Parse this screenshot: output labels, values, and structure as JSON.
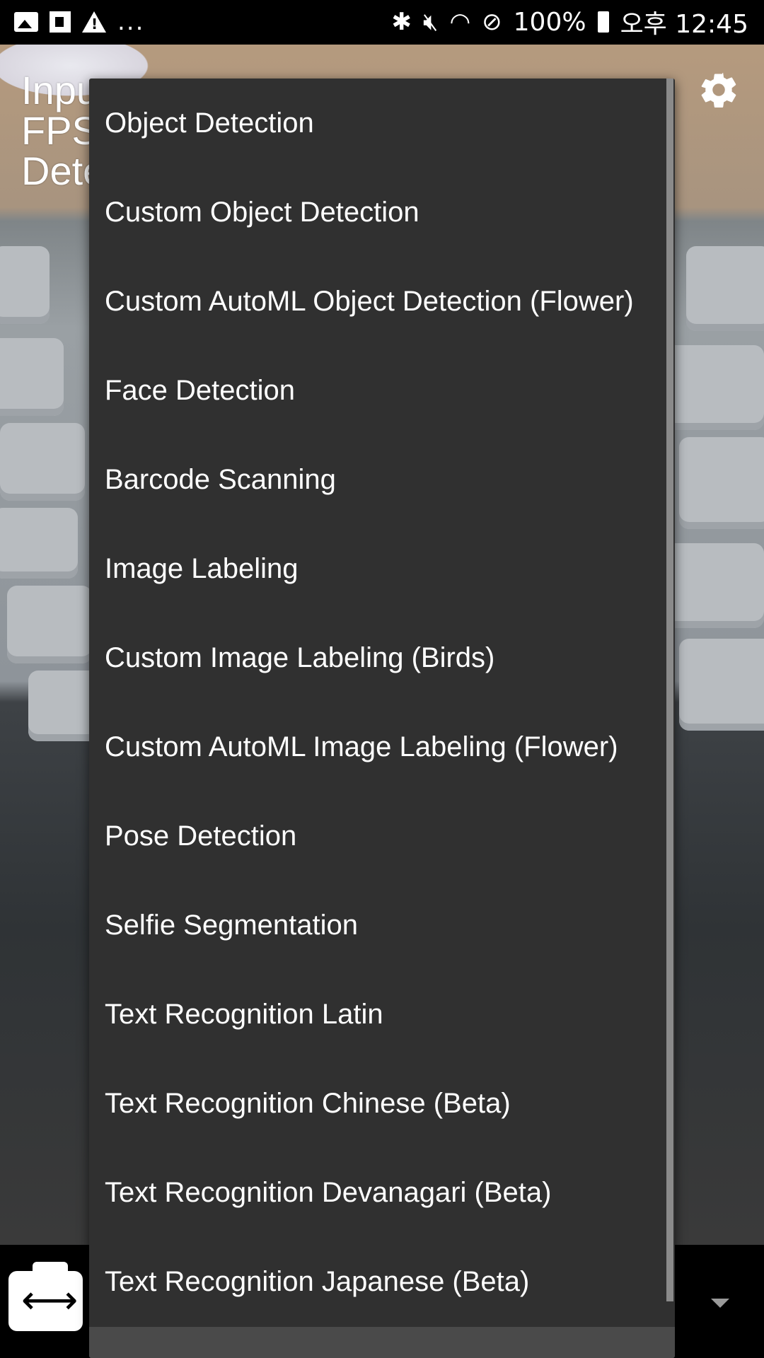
{
  "status_bar": {
    "left_icons": [
      "image-icon",
      "flipboard-icon",
      "warning-icon"
    ],
    "overflow": "...",
    "right_icons": [
      "bluetooth-icon",
      "mute-icon",
      "wifi-icon",
      "block-icon"
    ],
    "battery": "100%",
    "time": "오후 12:45"
  },
  "overlay": {
    "line1": "Inpu",
    "line2": "FPS",
    "line3": "Dete"
  },
  "icons": {
    "settings": "gear-icon",
    "facing_switch": "switch-camera-icon",
    "facing_glyph": "⟷",
    "spinner": "dropdown-arrow-icon"
  },
  "dropdown": {
    "items": [
      "Object Detection",
      "Custom Object Detection",
      "Custom AutoML Object Detection (Flower)",
      "Face Detection",
      "Barcode Scanning",
      "Image Labeling",
      "Custom Image Labeling (Birds)",
      "Custom AutoML Image Labeling (Flower)",
      "Pose Detection",
      "Selfie Segmentation",
      "Text Recognition Latin",
      "Text Recognition Chinese (Beta)",
      "Text Recognition Devanagari (Beta)",
      "Text Recognition Japanese (Beta)"
    ]
  }
}
